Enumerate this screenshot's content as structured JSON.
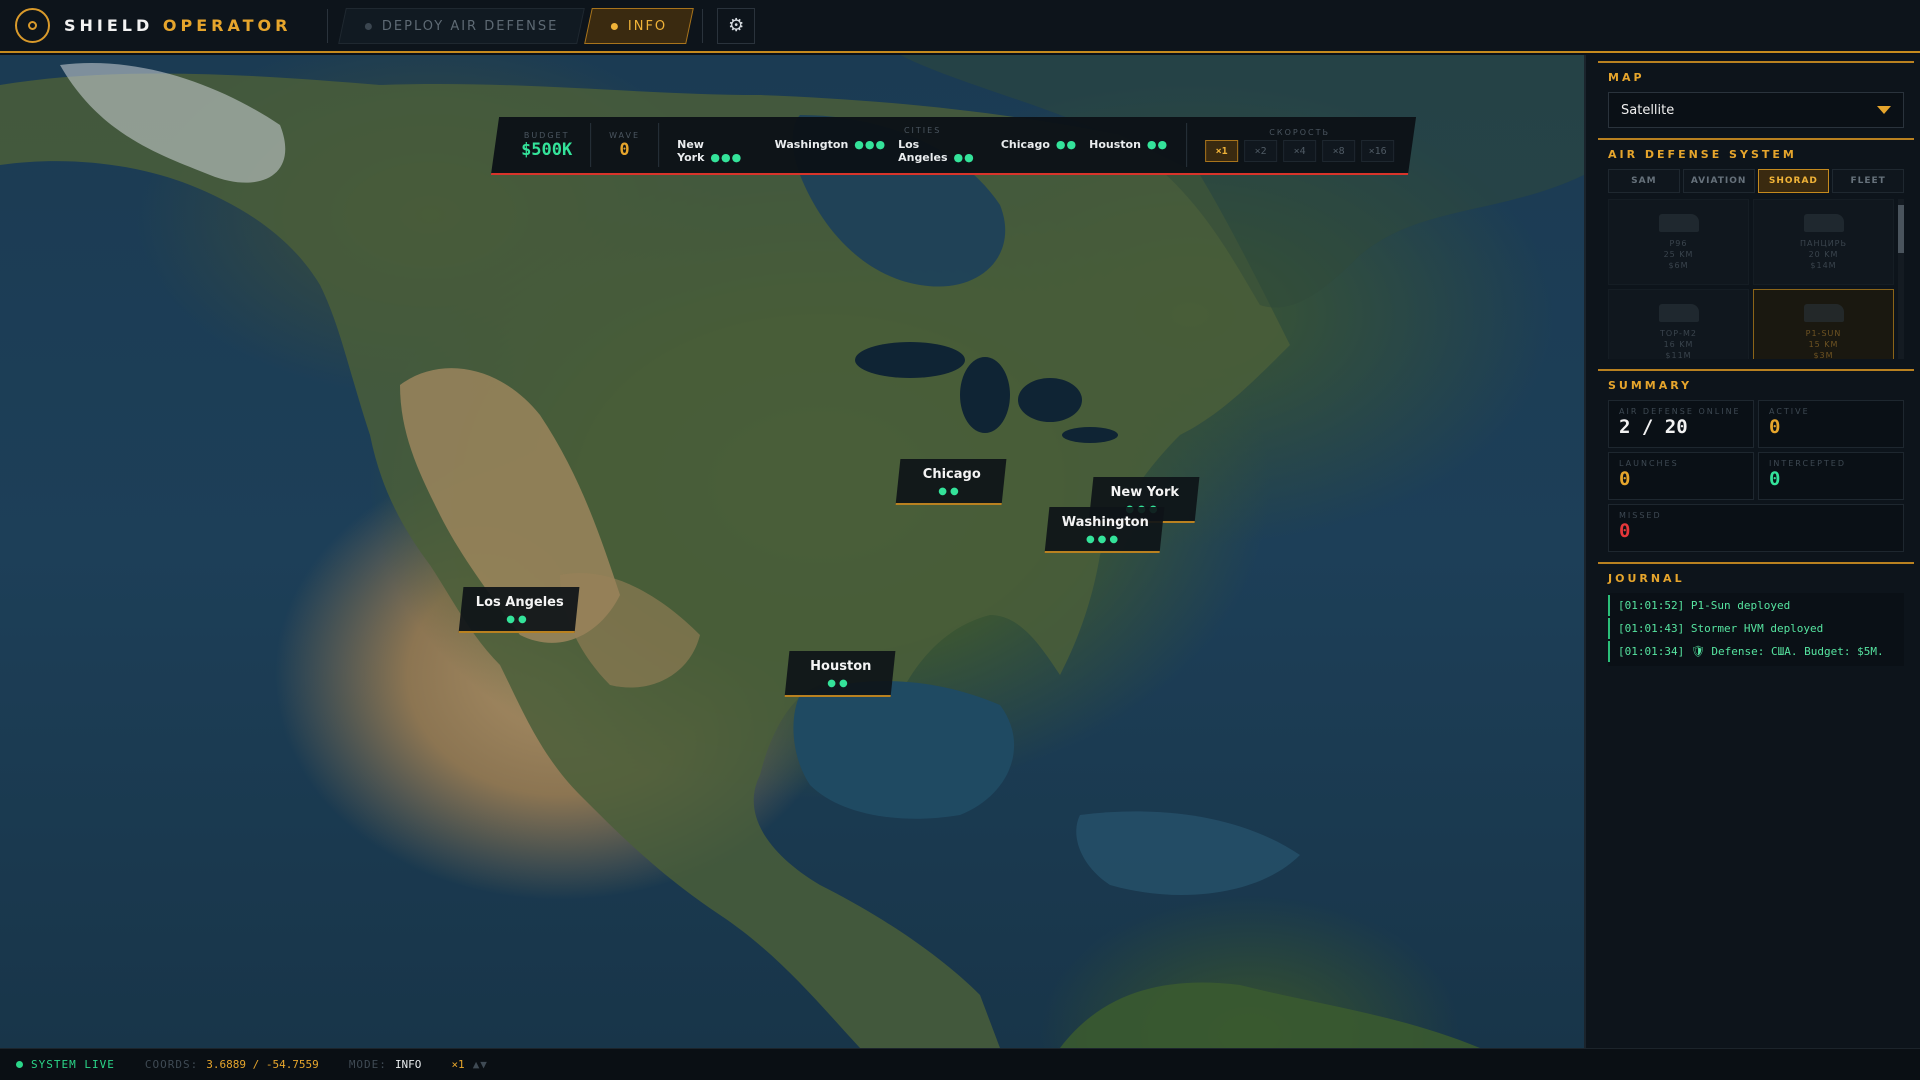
{
  "brand": {
    "name_primary": "SHIELD",
    "name_accent": "OPERATOR"
  },
  "tabs": [
    {
      "label": "DEPLOY AIR DEFENSE",
      "active": false
    },
    {
      "label": "INFO",
      "active": true
    }
  ],
  "settings_icon": "⚙",
  "hud": {
    "budget_label": "BUDGET",
    "budget_value": "$500K",
    "wave_label": "WAVE",
    "wave_value": "0",
    "cities_label": "CITIES",
    "cities": [
      {
        "name": "New York",
        "dots": "●●●"
      },
      {
        "name": "Washington",
        "dots": "●●●"
      },
      {
        "name": "Los Angeles",
        "dots": "●●"
      },
      {
        "name": "Chicago",
        "dots": "●●"
      },
      {
        "name": "Houston",
        "dots": "●●"
      }
    ],
    "speed_label": "СКОРОСТЬ",
    "speeds": [
      "×1",
      "×2",
      "×4",
      "×8",
      "×16"
    ],
    "speed_active": "×1"
  },
  "map_labels": [
    {
      "name": "Chicago",
      "dots": "●●"
    },
    {
      "name": "New York",
      "dots": "●●●"
    },
    {
      "name": "Washington",
      "dots": "●●●"
    },
    {
      "name": "Los Angeles",
      "dots": "●●"
    },
    {
      "name": "Houston",
      "dots": "●●"
    }
  ],
  "panel": {
    "map_section": {
      "title": "MAP",
      "selected": "Satellite"
    },
    "ads_section": {
      "title": "AIR DEFENSE SYSTEM",
      "categories": [
        "SAM",
        "AVIATION",
        "SHORAD",
        "FLEET"
      ],
      "active_category": "SHORAD",
      "units": [
        {
          "name": "Р96",
          "range": "25 KM",
          "cost": "$6M"
        },
        {
          "name": "ПАНЦИРЬ",
          "range": "20 KM",
          "cost": "$14M"
        },
        {
          "name": "ТОР-М2",
          "range": "16 KM",
          "cost": "$11M"
        },
        {
          "name": "P1-SUN",
          "range": "15 KM",
          "cost": "$3M"
        }
      ]
    },
    "summary": {
      "title": "SUMMARY",
      "online_label": "AIR DEFENSE ONLINE",
      "online_value": "2 / 20",
      "active_label": "ACTIVE",
      "active_value": "0",
      "launches_label": "LAUNCHES",
      "launches_value": "0",
      "intercepted_label": "INTERCEPTED",
      "intercepted_value": "0",
      "missed_label": "MISSED",
      "missed_value": "0"
    },
    "journal": {
      "title": "JOURNAL",
      "entries": [
        "[01:01:52] P1-Sun deployed",
        "[01:01:43] Stormer HVM deployed",
        "[01:01:34] 🛡 Defense: США. Budget: $5M."
      ]
    }
  },
  "statusbar": {
    "live": "SYSTEM LIVE",
    "coords_label": "COORDS:",
    "coords_value": "3.6889 / -54.7559",
    "mode_label": "MODE:",
    "mode_value": "INFO",
    "speed_value": "×1",
    "speed_suffix": "▲▼"
  },
  "colors": {
    "accent": "#e6a52c",
    "green": "#34e39a",
    "red": "#e5373a",
    "panel": "#0d141b"
  }
}
